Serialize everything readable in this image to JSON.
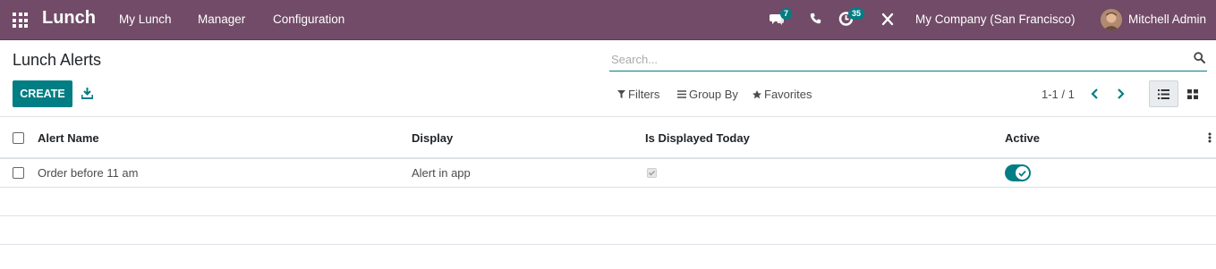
{
  "navbar": {
    "app_name": "Lunch",
    "menus": [
      "My Lunch",
      "Manager",
      "Configuration"
    ],
    "messages_badge": "7",
    "activity_badge": "35",
    "company": "My Company (San Francisco)",
    "user": "Mitchell Admin",
    "accent_color": "#714b67"
  },
  "control_panel": {
    "title": "Lunch Alerts",
    "search_placeholder": "Search...",
    "create_label": "CREATE",
    "filters_label": "Filters",
    "groupby_label": "Group By",
    "favorites_label": "Favorites",
    "pager": "1-1 / 1",
    "primary_color": "#017e84"
  },
  "table": {
    "columns": [
      "Alert Name",
      "Display",
      "Is Displayed Today",
      "Active"
    ],
    "rows": [
      {
        "alert_name": "Order before 11 am",
        "display": "Alert in app",
        "is_displayed_today": true,
        "active": true
      }
    ]
  }
}
